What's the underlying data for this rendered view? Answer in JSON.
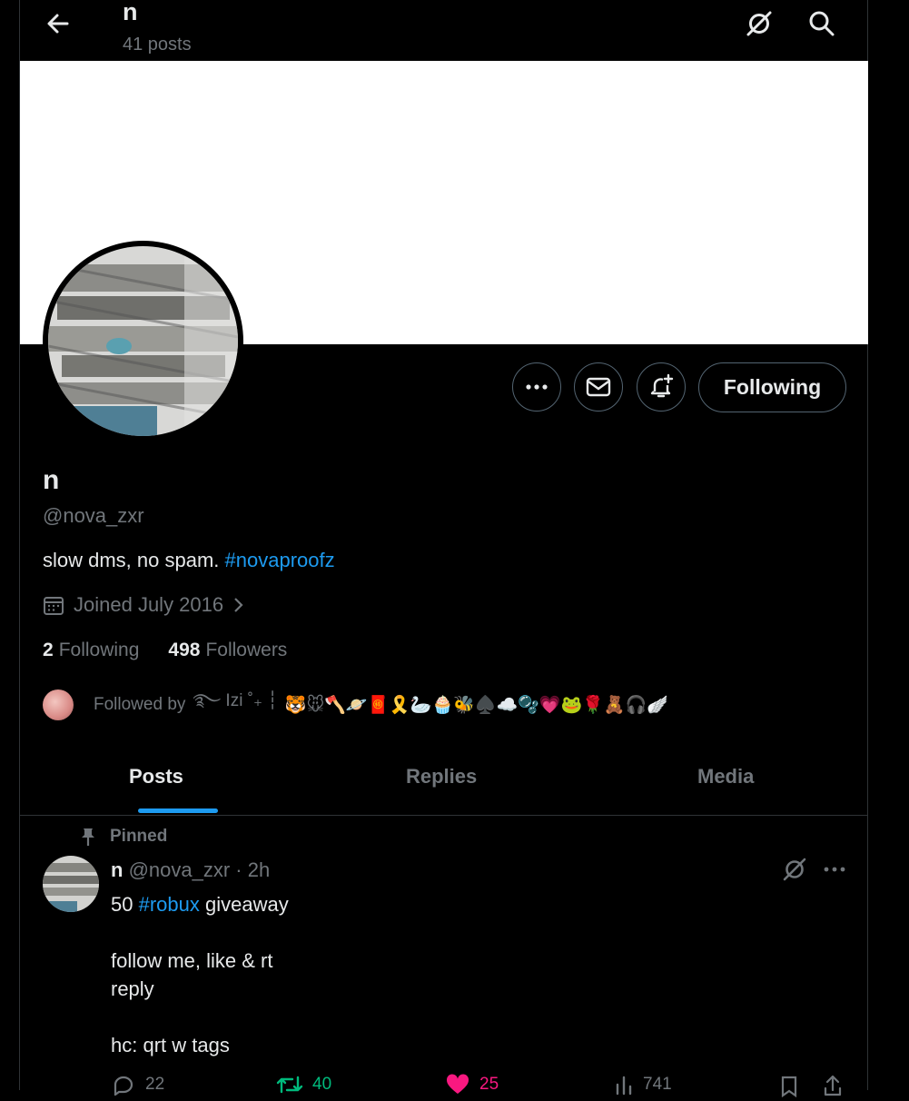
{
  "header": {
    "name": "n",
    "post_count": "41 posts"
  },
  "profile": {
    "display_name": "n",
    "handle": "@nova_zxr",
    "bio_text": "slow dms, no spam. ",
    "bio_hashtag": "#novaproofz",
    "joined": "Joined July 2016",
    "following_count": "2",
    "following_label": "Following",
    "followers_count": "498",
    "followers_label": "Followers",
    "followed_by_label": "Followed by",
    "followed_by_name": "࿐ Izi ˚₊ ┆",
    "followed_by_emojis": "🐯🐭🪓🪐🧧🎗️🦢🧁🐝♠️☁️🫧💗🐸🌹🧸🎧🪽"
  },
  "actions": {
    "following_button": "Following"
  },
  "tabs": [
    "Posts",
    "Replies",
    "Media"
  ],
  "post": {
    "pinned_label": "Pinned",
    "author_name": "n",
    "author_handle": "@nova_zxr",
    "time": " · 2h",
    "line1_prefix": "50 ",
    "line1_hashtag": "#robux",
    "line1_suffix": " giveaway",
    "line2": "follow me, like & rt",
    "line3": "reply",
    "line4": "hc: qrt w tags",
    "replies": "22",
    "reposts": "40",
    "likes": "25",
    "views": "741"
  },
  "colors": {
    "accent": "#1d9bf0",
    "muted": "#71767b",
    "repost": "#00ba7c",
    "like": "#f91880"
  }
}
